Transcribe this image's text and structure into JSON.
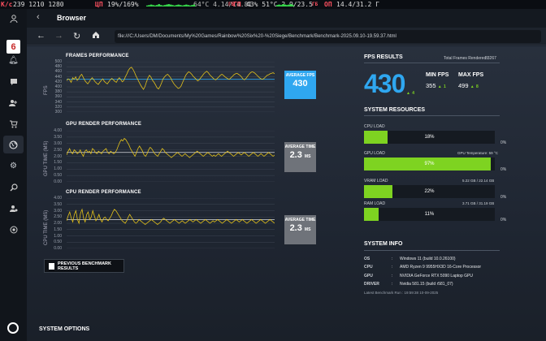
{
  "osd": {
    "k": "К/с",
    "k_vals": "239 1210 1280",
    "gpu_seg": "64°С 4.14/14.81",
    "gpu_unit": "ГБ",
    "cpu_lbl": "ЦП",
    "cpu_vals": "19%/169%",
    "ram_lbl": "ГП",
    "ram_vals": "43% 51°С 2.9/23.5",
    "ram_unit": "ГБ",
    "op_lbl": "ОП",
    "op_vals": "14.4/31.2 Г"
  },
  "browser": {
    "title": "Browser",
    "url": "file:///C:/Users/DM/Documents/My%20Games/Rainbow%20Six%20-%20Siege/Benchmark/Benchmark-2025.09.10-19.59.37.html"
  },
  "charts": {
    "frames": {
      "title": "FRAMES PERFORMANCE",
      "ylabel": "FPS",
      "avg_label": "AVERAGE FPS",
      "avg_value": "430",
      "avg_unit": ""
    },
    "gpu": {
      "title": "GPU RENDER PERFORMANCE",
      "ylabel": "GPU TIME (MS)",
      "avg_label": "AVERAGE TIME",
      "avg_value": "2.3",
      "avg_unit": "MS"
    },
    "cpu": {
      "title": "CPU RENDER PERFORMANCE",
      "ylabel": "CPU TIME (MS)",
      "avg_label": "AVERAGE TIME",
      "avg_value": "2.3",
      "avg_unit": "MS"
    }
  },
  "chart_data": [
    {
      "type": "line",
      "title": "FRAMES PERFORMANCE",
      "ylabel": "FPS",
      "ylim": [
        300,
        500
      ],
      "yticks": [
        "500",
        "480",
        "460",
        "440",
        "420",
        "400",
        "380",
        "360",
        "340",
        "320",
        "300"
      ],
      "average": 430,
      "series": [
        {
          "values": [
            425,
            432,
            428,
            418,
            436,
            430,
            440,
            426,
            432,
            444,
            450,
            438,
            426,
            418,
            412,
            420,
            430,
            436,
            428,
            420,
            414,
            410,
            418,
            426,
            432,
            422,
            416,
            412,
            420,
            428,
            434,
            428,
            422,
            418,
            430,
            436,
            428,
            420,
            426,
            440,
            452,
            466,
            474,
            478,
            470,
            458,
            444,
            432,
            420,
            408,
            398,
            390,
            402,
            420,
            436,
            446,
            438,
            426,
            418,
            408,
            396,
            392,
            402,
            416,
            432,
            440,
            446,
            450,
            444,
            436,
            424,
            414,
            406,
            400,
            394,
            396,
            404,
            418,
            432,
            446,
            454,
            460,
            456,
            450,
            442,
            436,
            430,
            424,
            428,
            436,
            444,
            452,
            458,
            462,
            456,
            448,
            442,
            436,
            430,
            428,
            434,
            440,
            446,
            450,
            446,
            440,
            436,
            432,
            430,
            436,
            442,
            448,
            452,
            454,
            450,
            446,
            440,
            432,
            428,
            434,
            442,
            450,
            456,
            460,
            458,
            454,
            448,
            442,
            436,
            432,
            430,
            434,
            440,
            446,
            448,
            452,
            454,
            456,
            452
          ]
        }
      ]
    },
    {
      "type": "line",
      "title": "GPU RENDER PERFORMANCE",
      "ylabel": "GPU TIME (MS)",
      "ylim": [
        0,
        4
      ],
      "yticks": [
        "4.00",
        "3.50",
        "3.00",
        "2.50",
        "2.00",
        "1.50",
        "1.00",
        "0.50",
        "0.00"
      ],
      "average": 2.3,
      "series": [
        {
          "values": [
            2.1,
            2.4,
            2.6,
            2.3,
            2.2,
            2.5,
            2.4,
            2.2,
            2.3,
            2.5,
            2.2,
            2.0,
            2.4,
            2.5,
            2.3,
            2.4,
            2.2,
            2.6,
            2.5,
            2.3,
            2.2,
            2.4,
            2.3,
            2.2,
            2.4,
            2.5,
            2.6,
            2.3,
            2.2,
            2.4,
            2.3,
            2.2,
            2.3,
            2.5,
            2.8,
            3.1,
            3.3,
            3.2,
            3.4,
            3.3,
            3.1,
            2.9,
            2.6,
            2.4,
            2.2,
            2.0,
            2.3,
            2.6,
            2.8,
            2.6,
            2.4,
            2.1,
            2.0,
            2.2,
            2.5,
            2.7,
            2.6,
            2.4,
            2.2,
            2.1,
            2.0,
            2.2,
            2.4,
            2.6,
            2.5,
            2.3,
            2.2,
            2.1,
            2.0,
            1.9,
            2.0,
            2.1,
            2.2,
            2.3,
            2.2,
            2.1,
            2.0,
            2.1,
            2.2,
            2.1,
            2.0,
            1.9,
            2.0,
            2.1,
            2.2,
            2.3,
            2.4,
            2.3,
            2.2,
            2.1,
            2.0,
            2.1,
            2.2,
            2.3,
            2.2,
            2.1,
            2.0,
            2.1,
            2.0,
            2.1,
            2.2,
            2.1,
            2.0,
            2.1,
            2.2,
            2.3,
            2.4,
            2.3,
            2.2,
            2.1,
            2.0,
            2.1,
            2.2,
            2.3,
            2.2,
            2.1,
            2.2,
            2.3,
            2.2,
            2.1,
            2.0,
            2.1,
            2.2,
            2.3,
            2.2,
            2.1,
            2.0,
            2.1,
            2.2,
            2.1,
            2.0,
            2.1,
            2.2,
            2.3,
            2.2,
            2.1,
            2.0,
            2.1
          ]
        }
      ]
    },
    {
      "type": "line",
      "title": "CPU RENDER PERFORMANCE",
      "ylabel": "CPU TIME (MS)",
      "ylim": [
        0,
        4
      ],
      "yticks": [
        "4.00",
        "3.50",
        "3.00",
        "2.50",
        "2.00",
        "1.50",
        "1.00",
        "0.50",
        "0.00"
      ],
      "average": 2.3,
      "series": [
        {
          "values": [
            2.2,
            2.6,
            2.9,
            2.4,
            2.1,
            2.7,
            3.0,
            2.3,
            2.0,
            2.8,
            3.1,
            2.4,
            2.1,
            2.7,
            2.9,
            2.3,
            2.5,
            3.0,
            2.6,
            2.2,
            2.4,
            2.7,
            2.3,
            2.1,
            2.4,
            2.5,
            2.3,
            2.2,
            2.4,
            2.6,
            2.9,
            3.1,
            3.0,
            2.8,
            2.6,
            2.4,
            2.2,
            2.1,
            2.0,
            2.2,
            2.5,
            2.7,
            2.5,
            2.3,
            2.1,
            2.0,
            2.1,
            2.3,
            2.2,
            2.1,
            2.0,
            1.9,
            2.0,
            2.1,
            2.2,
            2.3,
            2.2,
            2.1,
            2.0,
            1.9,
            2.0,
            2.1,
            2.3,
            2.4,
            2.3,
            2.2,
            2.1,
            2.0,
            2.1,
            2.2,
            2.3,
            2.2,
            2.1,
            2.0,
            2.1,
            2.2,
            2.1,
            2.0,
            2.1,
            2.2,
            2.3,
            2.2,
            2.1,
            2.2,
            2.3,
            2.2,
            2.1,
            2.0,
            2.1,
            2.2,
            2.3,
            2.2,
            2.1,
            2.0,
            2.1,
            2.2,
            2.1,
            2.2,
            2.3,
            2.2,
            2.1,
            2.0,
            2.1,
            2.2,
            2.3,
            2.2,
            2.1,
            2.0,
            2.1,
            2.2,
            2.3,
            2.2,
            2.1,
            2.2,
            2.3,
            2.2,
            2.1,
            2.0,
            2.1,
            2.2,
            2.3,
            2.2,
            2.1,
            2.0,
            2.1,
            2.2,
            2.3,
            2.2,
            2.1,
            2.0,
            2.1,
            2.2,
            2.3,
            2.2,
            2.1,
            2.0
          ]
        }
      ]
    }
  ],
  "prev_button": "PREVIOUS BENCHMARK RESULTS",
  "system_options": "SYSTEM OPTIONS",
  "fps_results": {
    "title": "FPS RESULTS",
    "total_frames_label": "Total Frames Rendered :",
    "total_frames_value": "33267",
    "avg": "430",
    "avg_sub": "4",
    "min_label": "MIN FPS",
    "min_value": "355",
    "min_sub": "1",
    "max_label": "MAX FPS",
    "max_value": "499",
    "max_sub": "8"
  },
  "resources": {
    "title": "SYSTEM RESOURCES",
    "cpu": {
      "label": "CPU LOAD",
      "value": 18,
      "text": "18%",
      "zero": "0%"
    },
    "gpu": {
      "label": "GPU LOAD",
      "extra": "GPU Temperature: 59 °C",
      "value": 97,
      "text": "97%",
      "zero": "0%"
    },
    "vram": {
      "label": "VRAM LOAD",
      "extra": "5.22 GB / 22.14 GB",
      "value": 22,
      "text": "22%",
      "zero": "0%"
    },
    "ram": {
      "label": "RAM LOAD",
      "extra": "3.71 GB / 31.19 GB",
      "value": 11,
      "text": "11%",
      "zero": "0%"
    }
  },
  "sysinfo": {
    "title": "SYSTEM INFO",
    "rows": [
      {
        "k": "OS",
        "sep": ":",
        "v": "Windows 11 (build 10.0.26100)"
      },
      {
        "k": "CPU",
        "sep": ":",
        "v": "AMD Ryzen 9 9955HX3D 16-Core Processor"
      },
      {
        "k": "GPU",
        "sep": ":",
        "v": "NVIDIA GeForce RTX 5090 Laptop GPU"
      },
      {
        "k": "DRIVER",
        "sep": ":",
        "v": "Nvidia 581.15 (build r581_07)"
      }
    ],
    "latest": "Latest Benchmark Run : 19:59:38 10-09-2025"
  },
  "colors": {
    "accent": "#2fa7f0",
    "bar": "#7ed321",
    "line": "#e4c21a"
  }
}
